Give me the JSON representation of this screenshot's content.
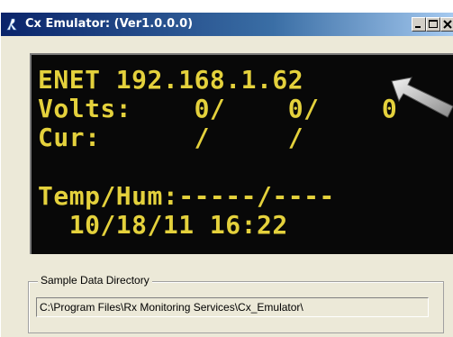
{
  "window": {
    "title": "Cx Emulator: (Ver1.0.0.0)",
    "icon": "rx-logo-icon",
    "controls": [
      "minimize",
      "maximize",
      "close"
    ]
  },
  "display": {
    "lines": [
      "ENET 192.168.1.62",
      "Volts:    0/    0/    0",
      "Cur:      /     /",
      "",
      "Temp/Hum:-----/----",
      "  10/18/11 16:22"
    ],
    "text_color": "#e4d13c",
    "background": "#080808"
  },
  "sample_data": {
    "group_label": "Sample Data Directory",
    "path": "C:\\Program Files\\Rx Monitoring Services\\Cx_Emulator\\"
  },
  "colors": {
    "titlebar_start": "#0a246a",
    "titlebar_end": "#a6caf0",
    "window_bg": "#ece9d8"
  }
}
